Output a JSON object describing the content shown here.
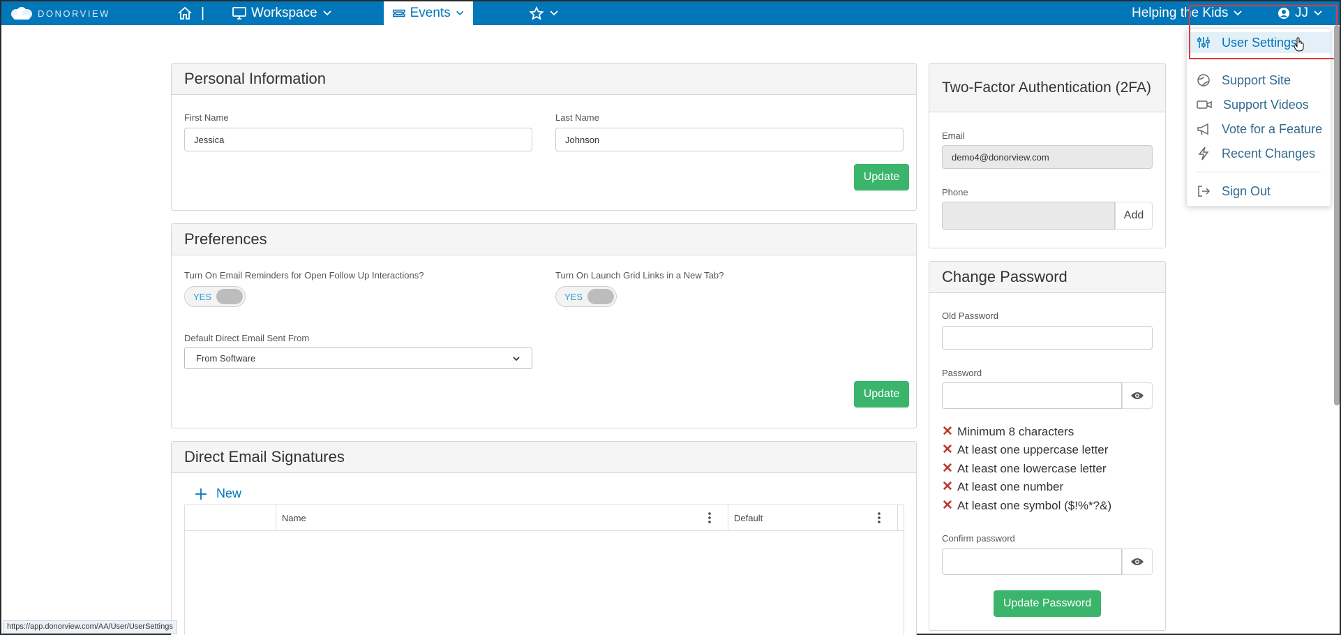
{
  "brand": {
    "name": "DONORVIEW"
  },
  "nav": {
    "separator": "|",
    "workspace": "Workspace",
    "events": "Events",
    "org": "Helping the Kids",
    "user": "JJ"
  },
  "personal": {
    "title": "Personal Information",
    "first_label": "First Name",
    "first_value": "Jessica",
    "last_label": "Last Name",
    "last_value": "Johnson",
    "update": "Update"
  },
  "preferences": {
    "title": "Preferences",
    "reminder_label": "Turn On Email Reminders for Open Follow Up Interactions?",
    "reminder_toggle": "YES",
    "grid_label": "Turn On Launch Grid Links in a New Tab?",
    "grid_toggle": "YES",
    "email_from_label": "Default Direct Email Sent From",
    "email_from_value": "From Software",
    "update": "Update"
  },
  "signatures": {
    "title": "Direct Email Signatures",
    "new": "New",
    "columns": [
      "Name",
      "Default"
    ]
  },
  "twofa": {
    "title": "Two-Factor Authentication (2FA)",
    "email_label": "Email",
    "email_value": "demo4@donorview.com",
    "phone_label": "Phone",
    "add": "Add"
  },
  "password": {
    "title": "Change Password",
    "old_label": "Old Password",
    "new_label": "Password",
    "rules": [
      "Minimum 8 characters",
      "At least one uppercase letter",
      "At least one lowercase letter",
      "At least one number",
      "At least one symbol ($!%*?&)"
    ],
    "confirm_label": "Confirm password",
    "submit": "Update Password"
  },
  "user_menu": {
    "items": [
      {
        "label": "User Settings",
        "icon": "sliders-icon"
      },
      {
        "label": "Support Site",
        "icon": "globe-icon"
      },
      {
        "label": "Support Videos",
        "icon": "video-icon"
      },
      {
        "label": "Vote for a Feature",
        "icon": "megaphone-icon"
      },
      {
        "label": "Recent Changes",
        "icon": "bolt-icon"
      },
      {
        "label": "Sign Out",
        "icon": "sign-out-icon"
      }
    ]
  },
  "status_url": "https://app.donorview.com/AA/User/UserSettings",
  "colors": {
    "nav": "#0176b8",
    "accent_green": "#3ab56b",
    "error_x": "#c0392b",
    "highlight": "#e23a3a"
  }
}
